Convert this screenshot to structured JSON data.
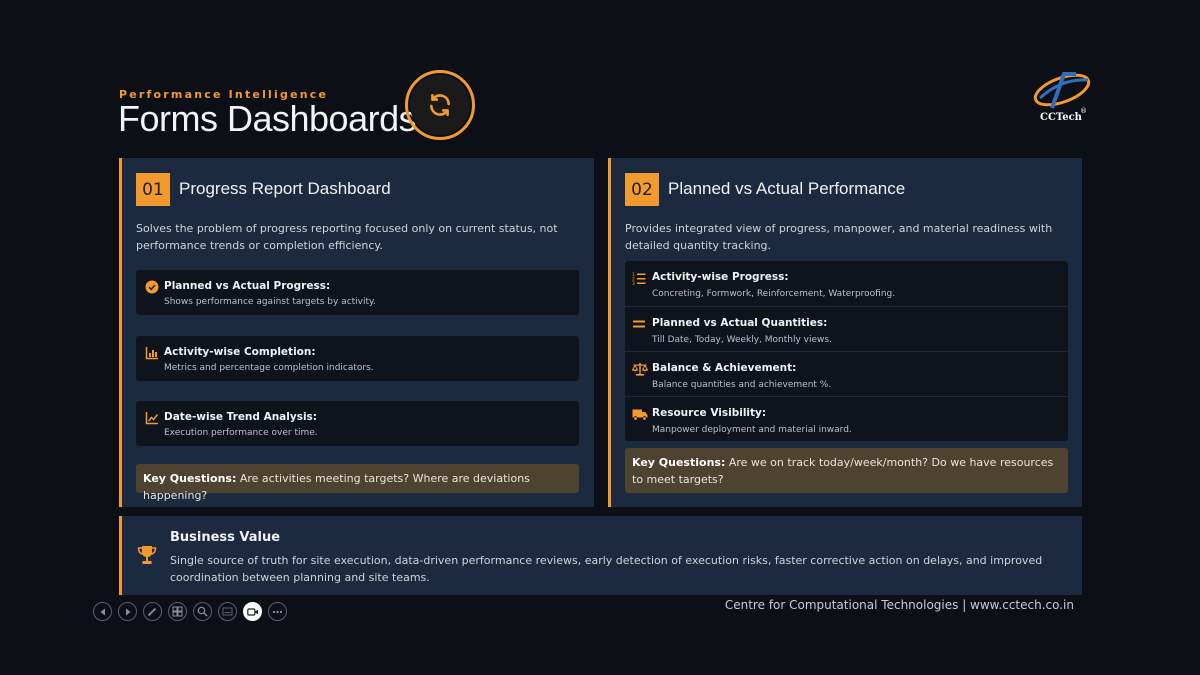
{
  "header": {
    "eyebrow": "Performance Intelligence",
    "title": "Forms Dashboards",
    "badge_icon": "refresh-icon",
    "logo_text": "CCTech",
    "logo_reg": "®"
  },
  "cards": [
    {
      "number": "01",
      "title": "Progress Report Dashboard",
      "description": "Solves the problem of progress reporting focused only on current status, not performance trends or completion efficiency.",
      "features": [
        {
          "icon": "check-circle-icon",
          "title": "Planned vs Actual Progress:",
          "desc": "Shows performance against targets by activity."
        },
        {
          "icon": "bar-chart-icon",
          "title": "Activity-wise Completion:",
          "desc": "Metrics and percentage completion indicators."
        },
        {
          "icon": "trend-line-icon",
          "title": "Date-wise Trend Analysis:",
          "desc": "Execution performance over time."
        }
      ],
      "key_questions_label": "Key Questions:",
      "key_questions": " Are activities meeting targets? Where are deviations happening?"
    },
    {
      "number": "02",
      "title": "Planned vs Actual Performance",
      "description": "Provides integrated view of progress, manpower, and material readiness with detailed quantity tracking.",
      "features": [
        {
          "icon": "list-icon",
          "title": "Activity-wise Progress:",
          "desc": "Concreting, Formwork, Reinforcement, Waterproofing."
        },
        {
          "icon": "equals-icon",
          "title": "Planned vs Actual Quantities:",
          "desc": "Till Date, Today, Weekly, Monthly views."
        },
        {
          "icon": "balance-scale-icon",
          "title": "Balance & Achievement:",
          "desc": "Balance quantities and achievement %."
        },
        {
          "icon": "truck-icon",
          "title": "Resource Visibility:",
          "desc": "Manpower deployment and material inward."
        }
      ],
      "key_questions_label": "Key Questions:",
      "key_questions": " Are we on track today/week/month? Do we have resources to meet targets?"
    }
  ],
  "business_value": {
    "icon": "trophy-icon",
    "title": "Business Value",
    "text": "Single source of truth for site execution, data-driven performance reviews, early detection of execution risks, faster corrective action on delays, and improved coordination between planning and site teams."
  },
  "footer": "Centre for Computational Technologies | www.cctech.co.in",
  "colors": {
    "accent": "#f29a2e",
    "card_bg": "#1b2a3e",
    "page_bg": "#0c0f16",
    "feature_bg": "#0f141c",
    "keyq_bg": "#4e4330"
  },
  "controls": [
    "previous-icon",
    "next-icon",
    "pen-icon",
    "slides-icon",
    "zoom-icon",
    "subtitles-icon",
    "camera-icon",
    "more-icon"
  ]
}
